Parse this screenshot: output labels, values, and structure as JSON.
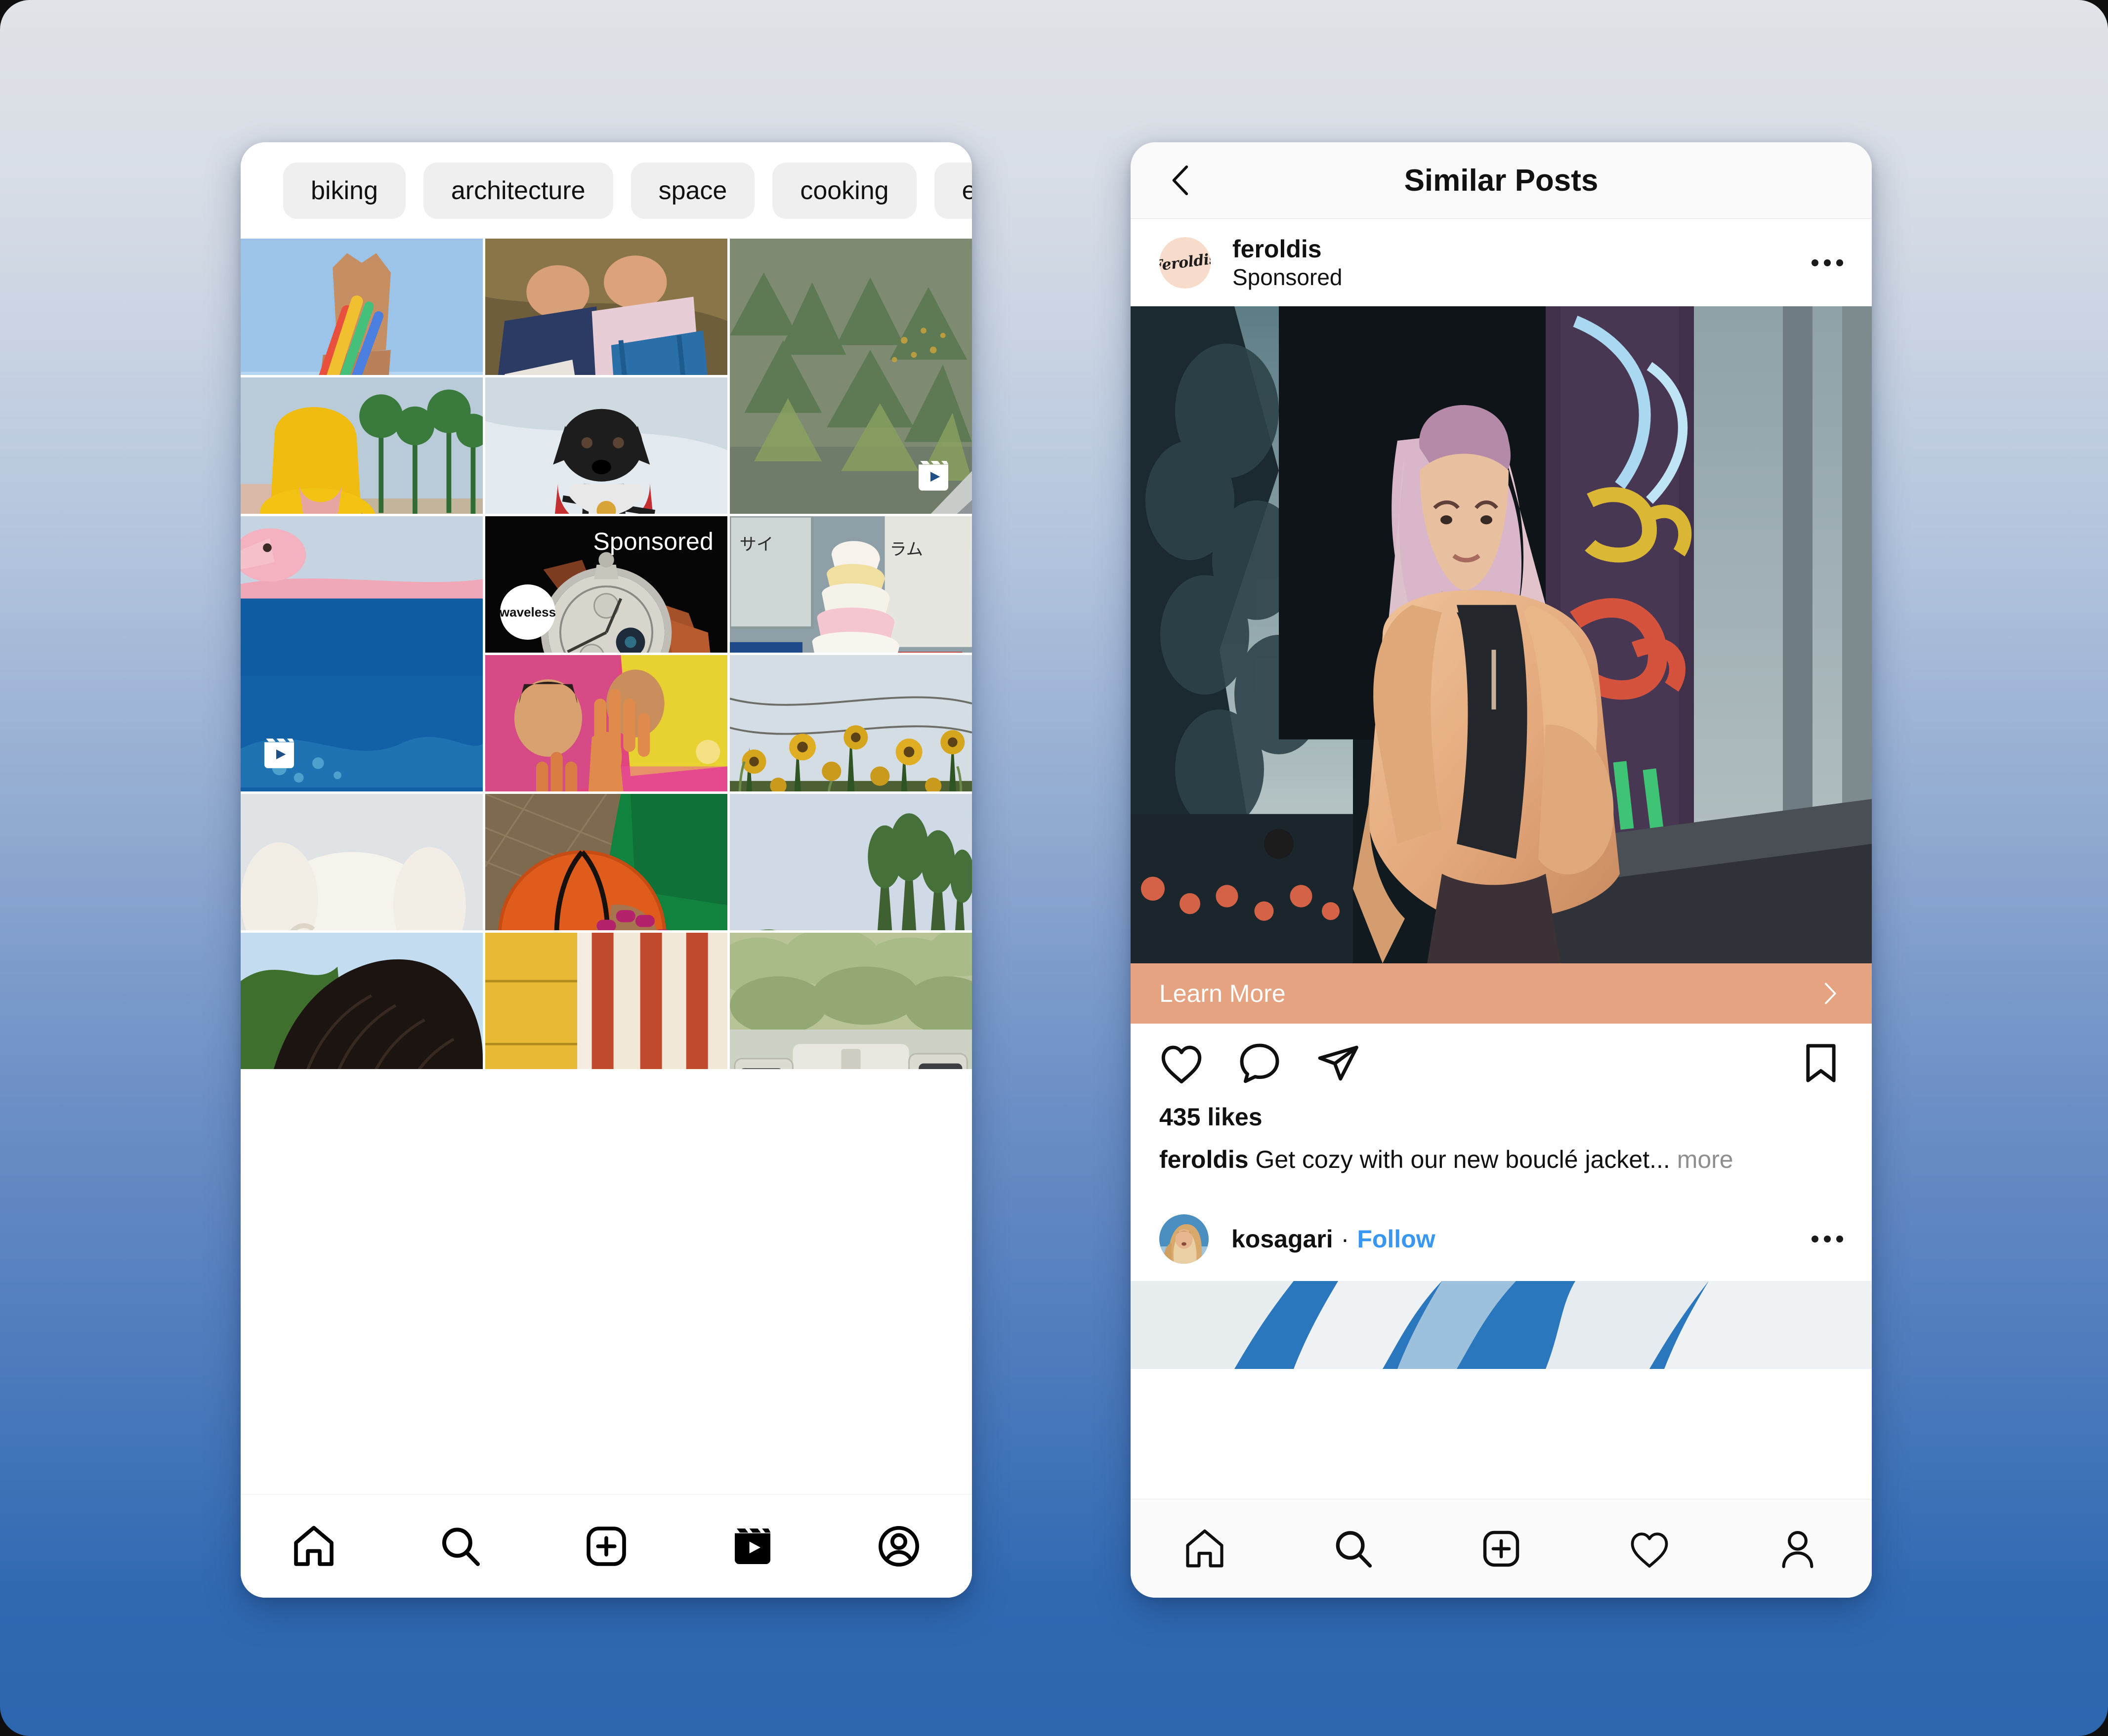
{
  "background": {
    "top_color": "#e0e3e7",
    "bottom_color": "#2b66af"
  },
  "left_phone": {
    "name": "instagram-explore-screen",
    "topic_chips": [
      {
        "label": "biking"
      },
      {
        "label": "architecture"
      },
      {
        "label": "space"
      },
      {
        "label": "cooking"
      },
      {
        "label": "ever"
      }
    ],
    "grid": [
      {
        "id": "hand-beads",
        "alt": "hand with rainbow beaded jewelry against blue sky",
        "kind": "photo"
      },
      {
        "id": "couple-grass",
        "alt": "two people laughing lying on grass",
        "kind": "photo"
      },
      {
        "id": "forest-road",
        "alt": "aerial view of road beside green forest",
        "kind": "reel",
        "tall": true
      },
      {
        "id": "yellow-raincoat",
        "alt": "person in yellow raincoat with palm trees",
        "kind": "photo"
      },
      {
        "id": "dog-snow",
        "alt": "black dog in red plaid coat in snow",
        "kind": "photo"
      },
      {
        "id": "flamingo-sea",
        "alt": "pink flamingo over deep blue sea",
        "kind": "reel",
        "tall": true
      },
      {
        "id": "watch-ad",
        "alt": "luxury wristwatch on black background",
        "kind": "sponsored",
        "sponsored_label": "Sponsored",
        "brand": "waveless"
      },
      {
        "id": "ice-cream",
        "alt": "soft serve ice cream cone in Japan",
        "kind": "photo"
      },
      {
        "id": "party-hands",
        "alt": "people dancing with hands raised in neon light",
        "kind": "photo"
      },
      {
        "id": "sunflowers",
        "alt": "field of sunflowers under power lines",
        "kind": "photo"
      },
      {
        "id": "white-dog",
        "alt": "fluffy white dog lying down",
        "kind": "photo"
      },
      {
        "id": "basketball",
        "alt": "hand holding a basketball, green sleeve",
        "kind": "photo"
      },
      {
        "id": "garden-trees",
        "alt": "garden with tall cactus and trees",
        "kind": "photo"
      },
      {
        "id": "curly-hair",
        "alt": "close up of person with dark curly hair",
        "kind": "photo"
      },
      {
        "id": "striped-wall",
        "alt": "yellow and red striped painted wall",
        "kind": "photo"
      },
      {
        "id": "patio-chairs",
        "alt": "outdoor patio table and chairs",
        "kind": "photo"
      }
    ],
    "tabbar": [
      {
        "icon": "home-icon",
        "label": "Home"
      },
      {
        "icon": "search-icon",
        "label": "Search"
      },
      {
        "icon": "plus-box-icon",
        "label": "Create"
      },
      {
        "icon": "reels-icon",
        "label": "Reels"
      },
      {
        "icon": "profile-icon",
        "label": "Profile"
      }
    ]
  },
  "right_phone": {
    "name": "instagram-similar-posts-screen",
    "header": {
      "back_icon": "chevron-left-icon",
      "title": "Similar Posts"
    },
    "post": {
      "avatar_text": "Feroldis",
      "avatar_bg": "#f8dccb",
      "username": "feroldis",
      "subtitle": "Sponsored",
      "menu_icon": "more-options-icon",
      "image_alt": "woman in tan teddy coat sitting outside a neon-lit storefront at dusk",
      "cta": {
        "label": "Learn More",
        "chevron": "chevron-right-icon",
        "bg": "#e5a381"
      },
      "actions": [
        {
          "icon": "heart-icon",
          "label": "Like"
        },
        {
          "icon": "comment-icon",
          "label": "Comment"
        },
        {
          "icon": "share-icon",
          "label": "Share"
        },
        {
          "icon": "bookmark-icon",
          "label": "Save"
        }
      ],
      "likes": "435 likes",
      "caption_user": "feroldis",
      "caption_text": "Get cozy with our new bouclé jacket...",
      "caption_more": "more"
    },
    "next_post": {
      "avatar_alt": "blonde woman at the beach",
      "username": "kosagari",
      "separator": "·",
      "follow_label": "Follow",
      "menu_icon": "more-options-icon",
      "image_alt": "blue sky with white clouds"
    },
    "tabbar": [
      {
        "icon": "home-icon",
        "label": "Home"
      },
      {
        "icon": "search-icon",
        "label": "Search"
      },
      {
        "icon": "plus-box-icon",
        "label": "Create"
      },
      {
        "icon": "heart-icon",
        "label": "Activity"
      },
      {
        "icon": "profile-icon",
        "label": "Profile"
      }
    ]
  }
}
